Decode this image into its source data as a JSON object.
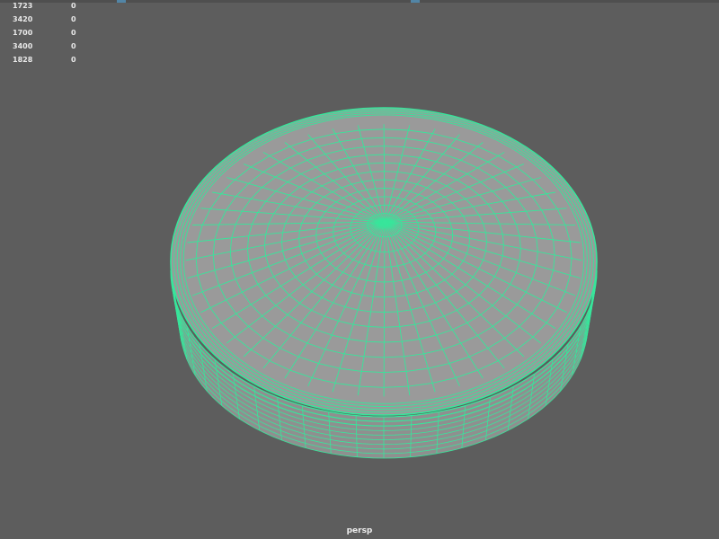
{
  "viewport": {
    "camera_label": "persp",
    "background_color": "#5d5d5d",
    "wireframe_color": "#38e59b",
    "mesh_fill_color": "#9a9a9a"
  },
  "hud": {
    "rows": [
      {
        "label": "1723",
        "value": "0"
      },
      {
        "label": "3420",
        "value": "0"
      },
      {
        "label": "1700",
        "value": "0"
      },
      {
        "label": "3400",
        "value": "0"
      },
      {
        "label": "1828",
        "value": "0"
      }
    ]
  }
}
